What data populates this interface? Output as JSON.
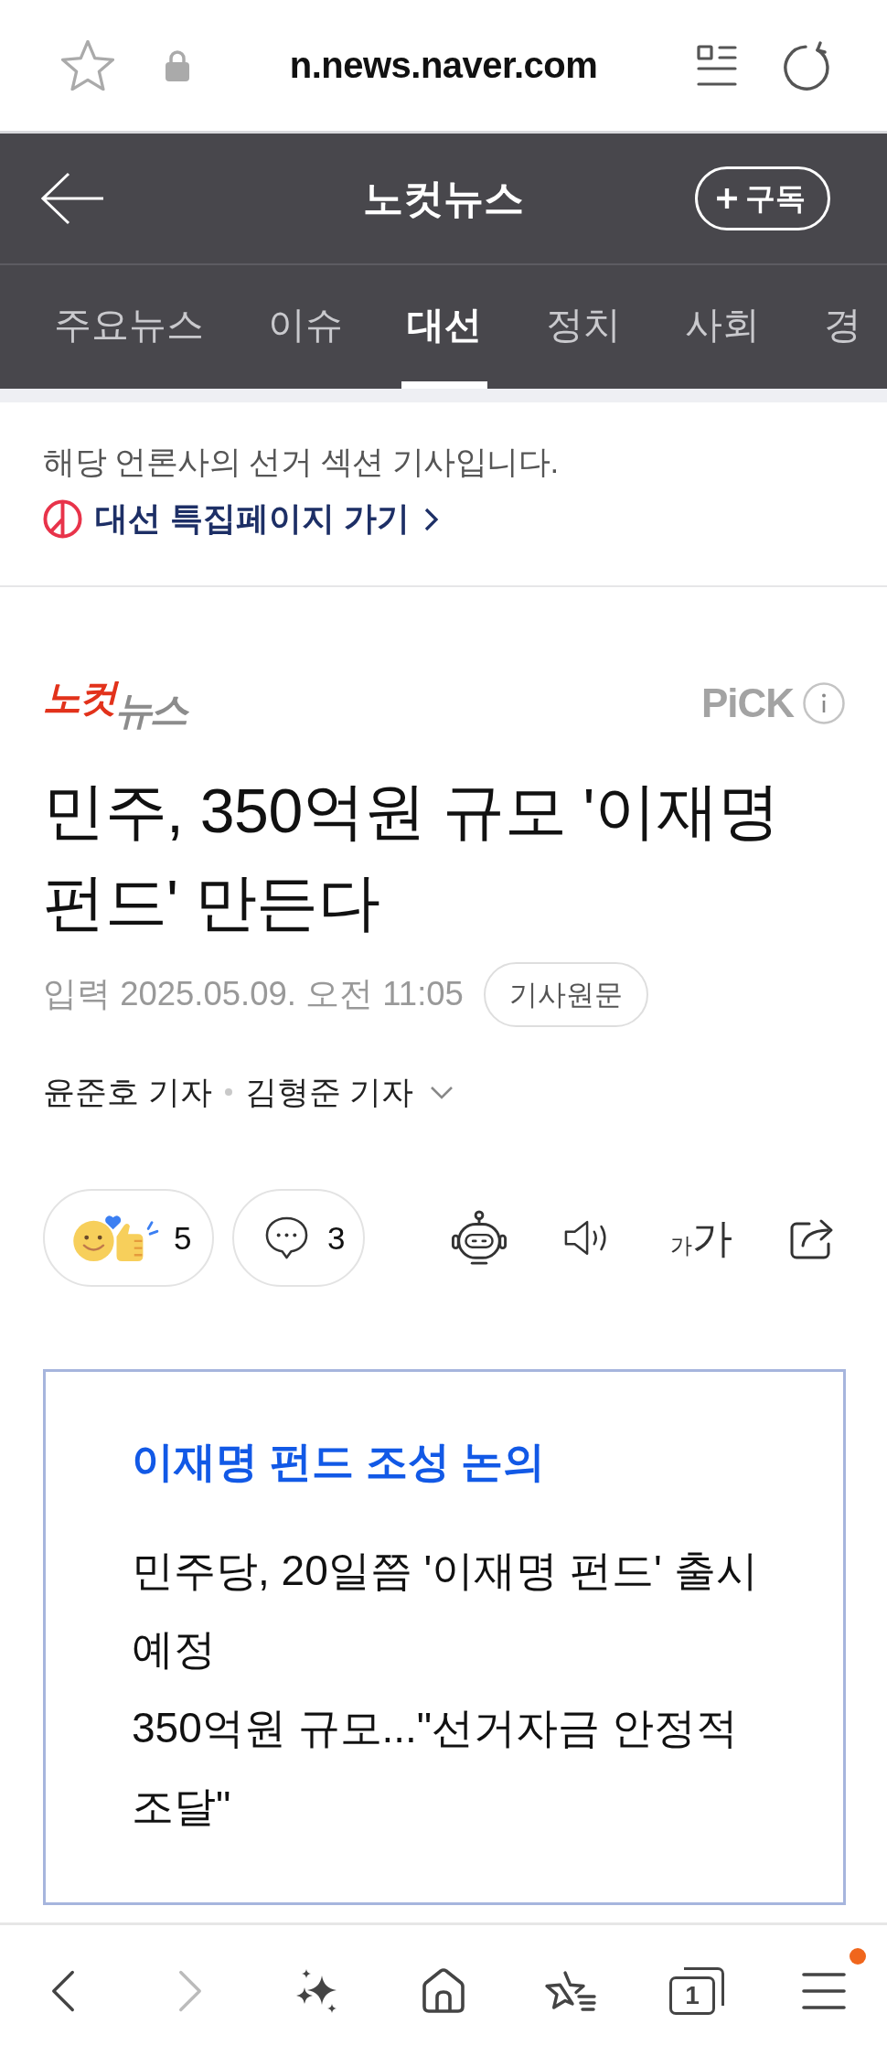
{
  "browser_bar": {
    "url": "n.news.naver.com"
  },
  "header": {
    "title": "노컷뉴스",
    "subscribe_label": "구독"
  },
  "tabs": [
    {
      "label": "주요뉴스",
      "selected": false
    },
    {
      "label": "이슈",
      "selected": false
    },
    {
      "label": "대선",
      "selected": true
    },
    {
      "label": "정치",
      "selected": false
    },
    {
      "label": "사회",
      "selected": false
    },
    {
      "label": "경",
      "selected": false
    }
  ],
  "election_notice": {
    "text": "해당 언론사의 선거 섹션 기사입니다.",
    "link": "대선 특집페이지 가기"
  },
  "article": {
    "press_logo": [
      {
        "text": "노컷",
        "color": "#e2321b"
      },
      {
        "text": "뉴스",
        "color": "#8c8c8c"
      }
    ],
    "pick_label": "PiCK",
    "headline": "민주, 350억원 규모 '이재명 펀드' 만든다",
    "date_line": "입력 2025.05.09. 오전 11:05",
    "original_button": "기사원문",
    "reporters": [
      "윤준호 기자",
      "김형준 기자"
    ]
  },
  "actions": {
    "reaction_count": "5",
    "comment_count": "3",
    "font_size_small": "가",
    "font_size_large": "가"
  },
  "summary": {
    "title": "이재명 펀드 조성 논의",
    "lines": [
      "민주당, 20일쯤 '이재명 펀드' 출시 예정",
      "350억원 규모...\"선거자금 안정적 조달\""
    ]
  },
  "bottom_nav": [
    {
      "kind": "back",
      "disabled": false,
      "notification": false
    },
    {
      "kind": "forward",
      "disabled": true,
      "notification": false
    },
    {
      "kind": "ai",
      "disabled": false,
      "notification": false
    },
    {
      "kind": "home",
      "disabled": false,
      "notification": false
    },
    {
      "kind": "bookmarks",
      "disabled": false,
      "notification": false
    },
    {
      "kind": "tabs",
      "disabled": false,
      "notification": false,
      "count": "1"
    },
    {
      "kind": "menu",
      "disabled": false,
      "notification": true
    }
  ]
}
